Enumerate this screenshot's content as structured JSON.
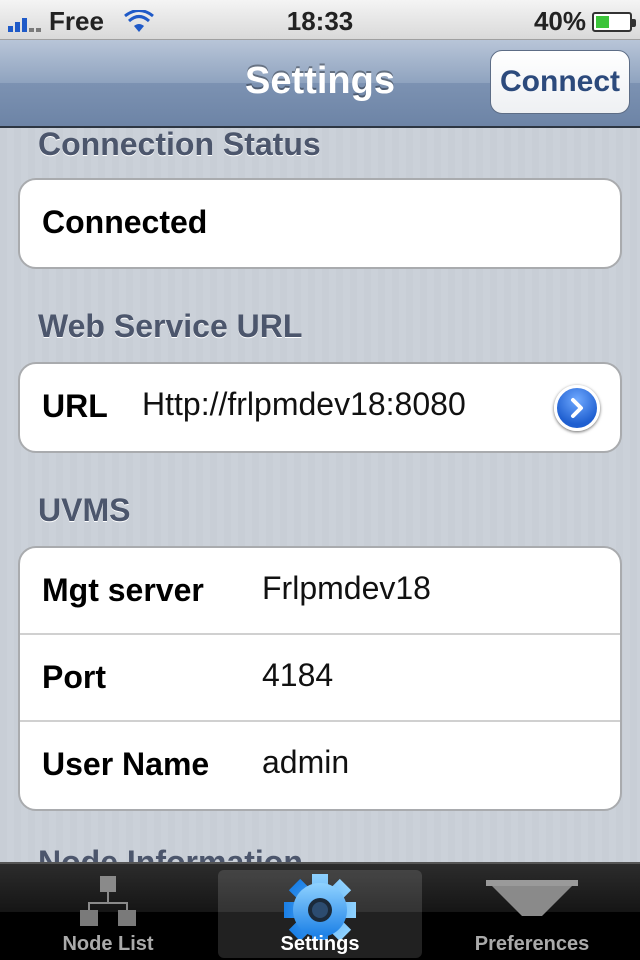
{
  "status_bar": {
    "carrier": "Free",
    "time": "18:33",
    "battery_percent": "40%",
    "battery_level": 0.4,
    "signal_icon": "signal-bars-icon",
    "wifi_icon": "wifi-icon"
  },
  "navbar": {
    "title": "Settings",
    "connect_label": "Connect"
  },
  "sections": {
    "connection_status": {
      "header": "Connection Status",
      "value": "Connected"
    },
    "web_service": {
      "header": "Web Service URL",
      "url_label": "URL",
      "url_value": "Http://frlpmdev18:8080"
    },
    "uvms": {
      "header": "UVMS",
      "rows": [
        {
          "label": "Mgt server",
          "value": "Frlpmdev18"
        },
        {
          "label": "Port",
          "value": "4184"
        },
        {
          "label": "User Name",
          "value": "admin"
        }
      ]
    },
    "next_partial": "Node Information"
  },
  "tabbar": {
    "tabs": [
      {
        "label": "Node List",
        "icon": "hierarchy-icon"
      },
      {
        "label": "Settings",
        "icon": "gear-icon"
      },
      {
        "label": "Preferences",
        "icon": "funnel-icon"
      }
    ],
    "selected_index": 1
  },
  "colors": {
    "accent": "#2c4a7c",
    "disclosure": "#1f5fd0",
    "section_header": "#4c566c"
  }
}
